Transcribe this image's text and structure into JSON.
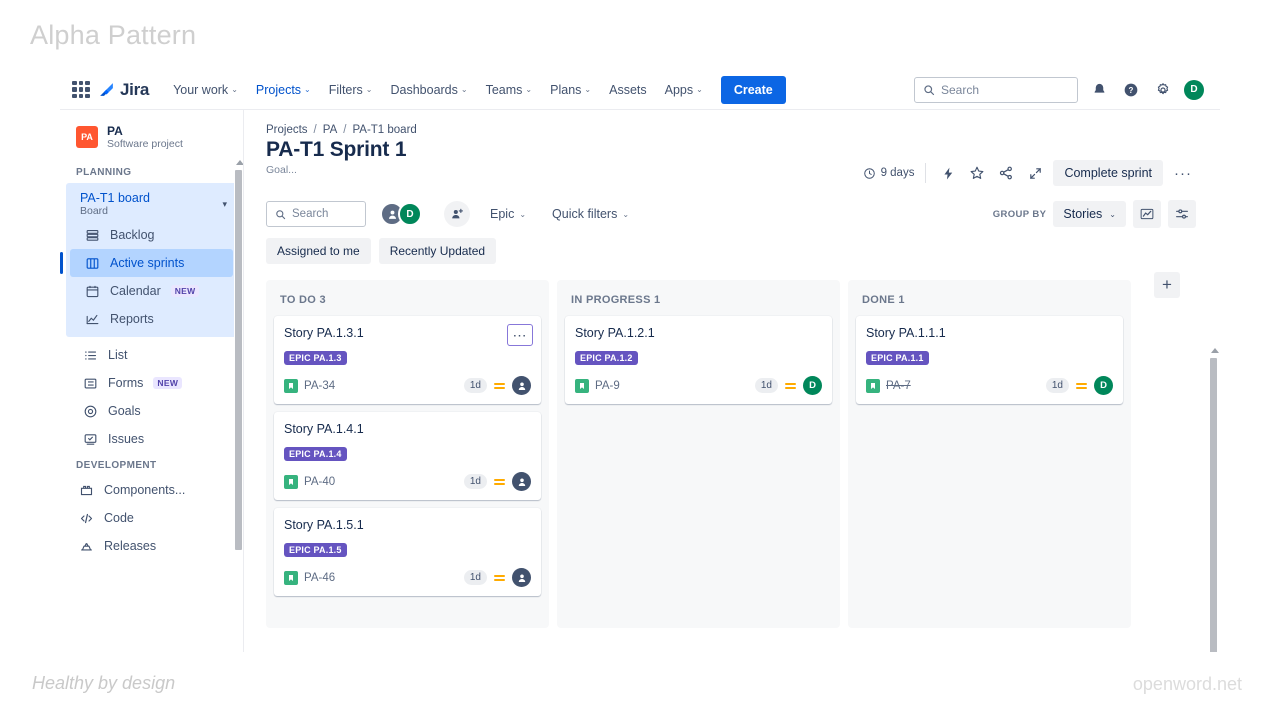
{
  "watermark": {
    "title": "Alpha Pattern",
    "footer_left": "Healthy by design",
    "footer_right": "openword.net"
  },
  "global_nav": {
    "product": "Jira",
    "items": [
      {
        "label": "Your work",
        "caret": "⌄"
      },
      {
        "label": "Projects",
        "caret": "⌄"
      },
      {
        "label": "Filters",
        "caret": "⌄"
      },
      {
        "label": "Dashboards",
        "caret": "⌄"
      },
      {
        "label": "Teams",
        "caret": "⌄"
      },
      {
        "label": "Plans",
        "caret": "⌄"
      },
      {
        "label": "Assets",
        "caret": ""
      },
      {
        "label": "Apps",
        "caret": "⌄"
      }
    ],
    "create_label": "Create",
    "search_placeholder": "Search",
    "avatar_initial": "D",
    "accent": "#0c66e4"
  },
  "sidebar": {
    "project": {
      "key": "PA",
      "name": "PA",
      "type": "Software project"
    },
    "planning_label": "PLANNING",
    "board": {
      "name": "PA-T1 board",
      "sub": "Board"
    },
    "planning_items": [
      {
        "label": "Backlog",
        "icon": "backlog-icon",
        "badge": ""
      },
      {
        "label": "Active sprints",
        "icon": "board-icon",
        "badge": ""
      },
      {
        "label": "Calendar",
        "icon": "calendar-icon",
        "badge": "NEW"
      },
      {
        "label": "Reports",
        "icon": "reports-icon",
        "badge": ""
      }
    ],
    "selected": "Active sprints",
    "other_items": [
      {
        "label": "List",
        "icon": "list-icon",
        "badge": ""
      },
      {
        "label": "Forms",
        "icon": "forms-icon",
        "badge": "NEW"
      },
      {
        "label": "Goals",
        "icon": "goals-icon",
        "badge": ""
      },
      {
        "label": "Issues",
        "icon": "issues-icon",
        "badge": ""
      }
    ],
    "development_label": "DEVELOPMENT",
    "development_items": [
      {
        "label": "Components...",
        "icon": "components-icon",
        "badge": ""
      },
      {
        "label": "Code",
        "icon": "code-icon",
        "badge": ""
      },
      {
        "label": "Releases",
        "icon": "releases-icon",
        "badge": ""
      }
    ]
  },
  "breadcrumb": {
    "p0": "Projects",
    "p1": "PA",
    "p2": "PA-T1 board",
    "sep": "/"
  },
  "header": {
    "title": "PA-T1 Sprint 1",
    "goal": "Goal...",
    "days_remaining": "9 days",
    "complete_sprint": "Complete sprint",
    "more": "···"
  },
  "toolbar": {
    "search_placeholder": "Search",
    "avatar_initial": "D",
    "epic_label": "Epic",
    "quick_filters_label": "Quick filters",
    "group_by_label": "GROUP BY",
    "group_by_value": "Stories",
    "chips": [
      "Assigned to me",
      "Recently Updated"
    ],
    "caret": "⌄"
  },
  "board": {
    "add_column": "+",
    "columns": [
      {
        "name": "TO DO",
        "count": "3",
        "header": "TO DO 3",
        "cards": [
          {
            "title": "Story PA.1.3.1",
            "epic": "EPIC PA.1.3",
            "key": "PA-34",
            "estimate": "1d",
            "priority": "medium",
            "assignee": "",
            "done": false,
            "menu_open": true
          },
          {
            "title": "Story PA.1.4.1",
            "epic": "EPIC PA.1.4",
            "key": "PA-40",
            "estimate": "1d",
            "priority": "medium",
            "assignee": "",
            "done": false,
            "menu_open": false
          },
          {
            "title": "Story PA.1.5.1",
            "epic": "EPIC PA.1.5",
            "key": "PA-46",
            "estimate": "1d",
            "priority": "medium",
            "assignee": "",
            "done": false,
            "menu_open": false
          }
        ]
      },
      {
        "name": "IN PROGRESS",
        "count": "1",
        "header": "IN PROGRESS 1",
        "cards": [
          {
            "title": "Story PA.1.2.1",
            "epic": "EPIC PA.1.2",
            "key": "PA-9",
            "estimate": "1d",
            "priority": "medium",
            "assignee": "D",
            "done": false,
            "menu_open": false
          }
        ]
      },
      {
        "name": "DONE",
        "count": "1",
        "header": "DONE 1",
        "cards": [
          {
            "title": "Story PA.1.1.1",
            "epic": "EPIC PA.1.1",
            "key": "PA-7",
            "estimate": "1d",
            "priority": "medium",
            "assignee": "D",
            "done": true,
            "menu_open": false
          }
        ]
      }
    ]
  },
  "colors": {
    "brand_blue": "#0052cc",
    "create_blue": "#0c66e4",
    "epic_purple": "#6554c0",
    "avatar_green": "#00875a",
    "project_orange": "#ff5630",
    "priority_orange": "#ffab00",
    "story_green": "#36b37e"
  }
}
